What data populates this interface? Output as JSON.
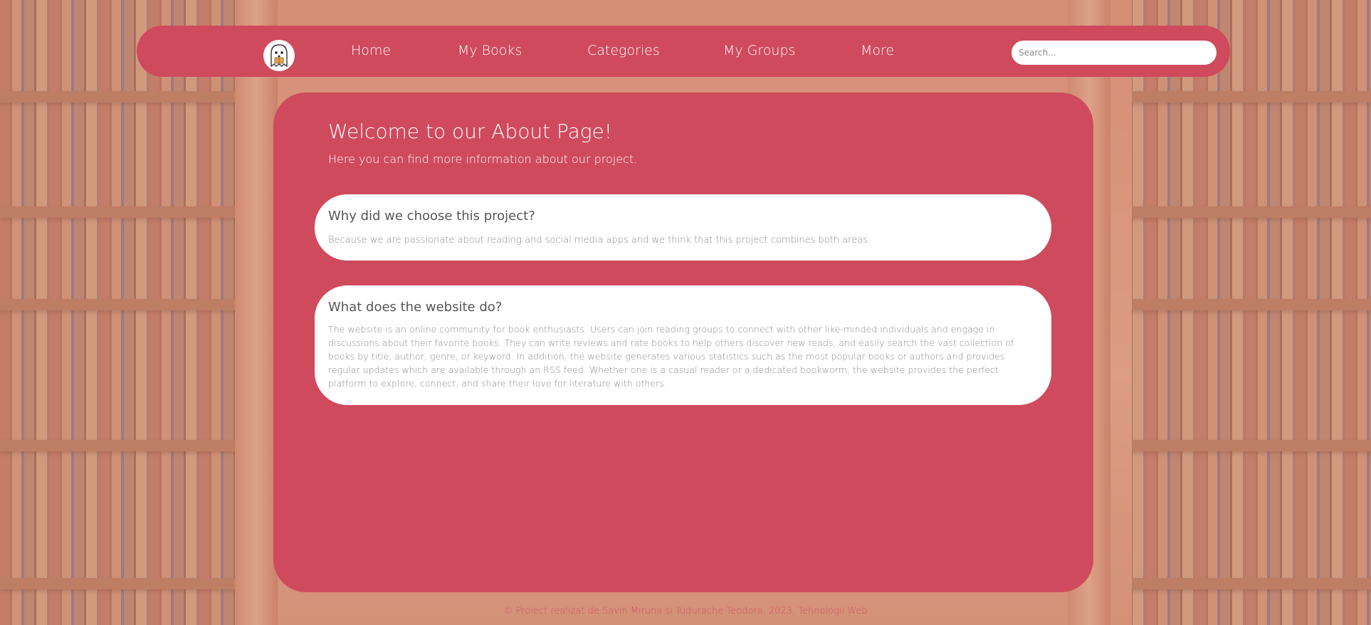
{
  "nav": {
    "logo_icon": "ghost-reading-icon",
    "links": [
      "Home",
      "My Books",
      "Categories",
      "My Groups",
      "More"
    ],
    "search_placeholder": "Search..."
  },
  "main": {
    "title": "Welcome to our About Page!",
    "subtitle": "Here you can find more information about our project.",
    "sections": [
      {
        "heading": "Why did we choose this project?",
        "text": "Because we are passionate about reading and social media apps and we think that this project combines both areas."
      },
      {
        "heading": "What does the website do?",
        "text": "The website is an online community for book enthusiasts. Users can join reading groups to connect with other like-minded individuals and engage in discussions about their favorite books. They can write reviews and rate books to help others discover new reads, and easily search the vast collection of books by title, author, genre, or keyword. In addition, the website generates various statistics such as the most popular books or authors and provides regular updates which are available through an RSS feed. Whether one is a casual reader or a dedicated bookworm, the website provides the perfect platform to explore, connect, and share their love for literature with others."
      }
    ]
  },
  "footer": {
    "text": "© Proiect realizat de Savin Miruna și Tudurache Teodora, 2023, Tehnologii Web"
  },
  "colors": {
    "accent": "#cf4a5d",
    "card": "#ffffff",
    "heading_text": "#555555",
    "body_text": "#8a8a8a"
  }
}
